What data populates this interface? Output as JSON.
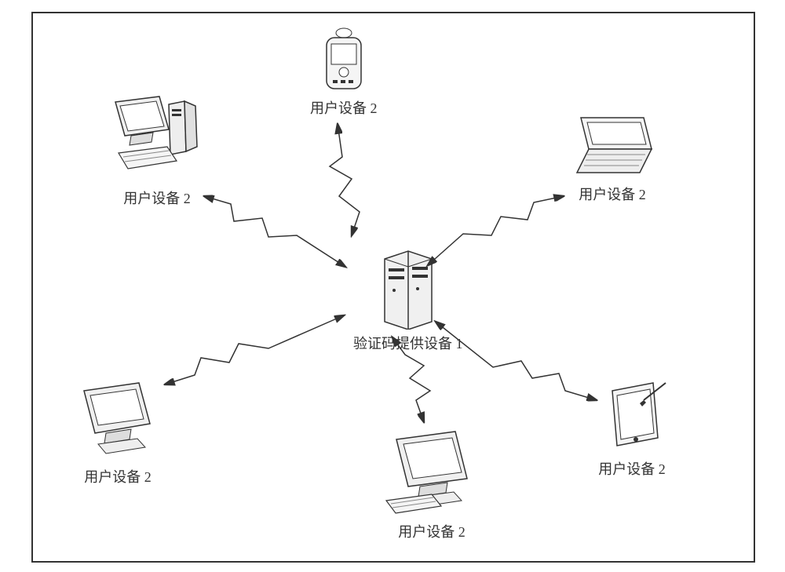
{
  "center": {
    "label": "验证码提供设备 1"
  },
  "clients": [
    {
      "label": "用户设备 2",
      "type": "pda"
    },
    {
      "label": "用户设备 2",
      "type": "laptop"
    },
    {
      "label": "用户设备 2",
      "type": "tablet"
    },
    {
      "label": "用户设备 2",
      "type": "crt-bottom"
    },
    {
      "label": "用户设备 2",
      "type": "crt-left"
    },
    {
      "label": "用户设备 2",
      "type": "desktop"
    }
  ]
}
